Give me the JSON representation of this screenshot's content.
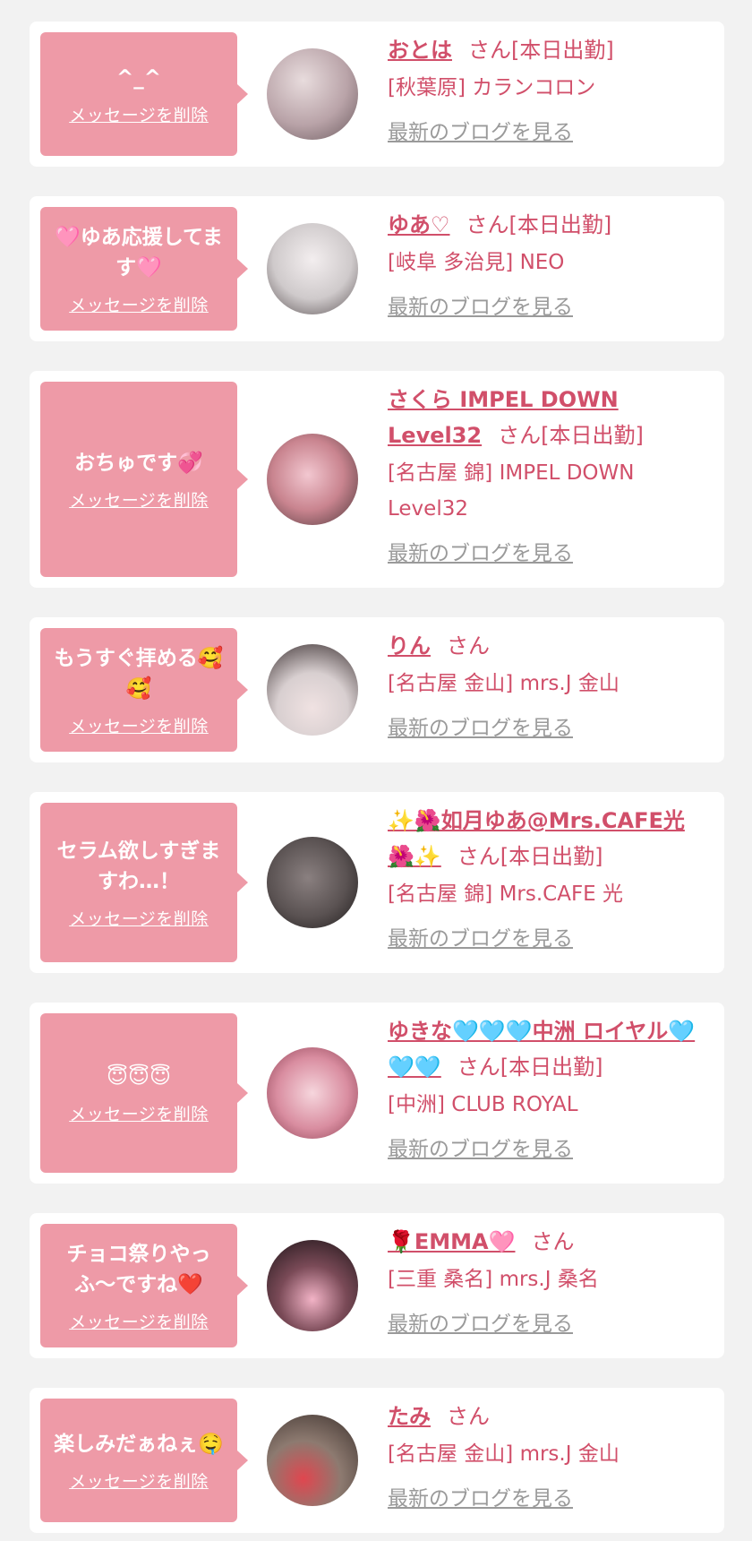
{
  "common": {
    "delete_label": "メッセージを削除",
    "blog_label": "最新のブログを見る",
    "san": "さん",
    "today_tag": "[本日出勤]"
  },
  "entries": [
    {
      "message": "^_^",
      "name": "おとは",
      "today": true,
      "shop": "[秋葉原] カランコロン",
      "avatar_color": "#b9a3a8"
    },
    {
      "message": "🩷ゆあ応援してます🩷",
      "name": "ゆあ♡",
      "today": true,
      "shop": "[岐阜 多治見] NEO",
      "avatar_color": "#cfcacb"
    },
    {
      "message": "おちゅです💞",
      "name": "さくら IMPEL DOWN Level32",
      "today": true,
      "shop": "[名古屋 錦] IMPEL DOWN Level32",
      "avatar_color": "#c9848f"
    },
    {
      "message": "もうすぐ拝める🥰🥰",
      "name": "りん",
      "today": false,
      "shop": "[名古屋 金山] mrs.J 金山",
      "avatar_color": "#d8cfd0"
    },
    {
      "message": "セラム欲しすぎますわ…！",
      "name": "✨🌺如月ゆあ@Mrs.CAFE光🌺✨",
      "today": true,
      "shop": "[名古屋 錦] Mrs.CAFE 光",
      "avatar_color": "#5a5252"
    },
    {
      "message": "😇😇😇",
      "name": "ゆきな🩵🩵🩵中洲 ロイヤル🩵🩵🩵",
      "today": true,
      "shop": "[中洲] CLUB ROYAL",
      "avatar_color": "#d98da0"
    },
    {
      "message": "チョコ祭りやっふ〜ですね❤️",
      "name": "🌹EMMA🩷",
      "today": false,
      "shop": "[三重 桑名] mrs.J 桑名",
      "avatar_color": "#3d2b31"
    },
    {
      "message": "楽しみだぁねぇ🤤",
      "name": "たみ",
      "today": false,
      "shop": "[名古屋 金山] mrs.J 金山",
      "avatar_color": "#8d7a70"
    }
  ]
}
